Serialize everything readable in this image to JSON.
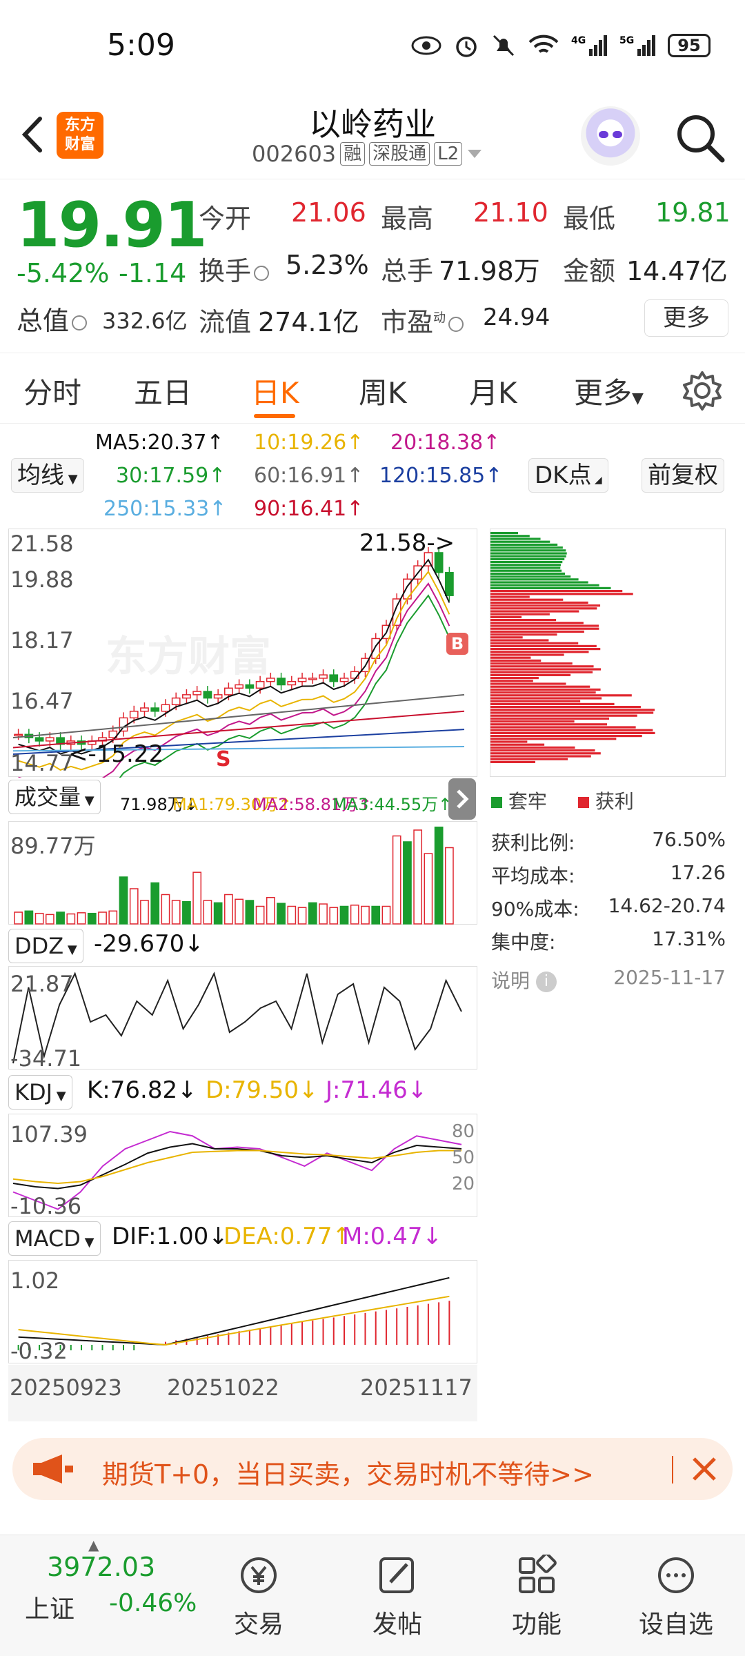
{
  "status_bar": {
    "time": "5:09",
    "battery": "95"
  },
  "header": {
    "logo_line1": "东方",
    "logo_line2": "财富",
    "stock_name": "以岭药业",
    "stock_code": "002603",
    "tag_margin": "融",
    "tag_connect": "深股通",
    "tag_level": "L2"
  },
  "quote": {
    "price": "19.91",
    "change_pct": "-5.42%",
    "change_val": "-1.14",
    "open_label": "今开",
    "open": "21.06",
    "high_label": "最高",
    "high": "21.10",
    "low_label": "最低",
    "low": "19.81",
    "turnover_label": "换手",
    "turnover": "5.23%",
    "volume_label": "总手",
    "volume": "71.98万",
    "amount_label": "金额",
    "amount": "14.47亿",
    "mktcap_label": "总值",
    "mktcap": "332.6亿",
    "float_label": "流值",
    "float_cap": "274.1亿",
    "pe_label": "市盈",
    "pe_sup": "动",
    "pe": "24.94",
    "more_label": "更多"
  },
  "tabs": [
    "分时",
    "五日",
    "日K",
    "周K",
    "月K",
    "更多"
  ],
  "ma_legend": {
    "ma5": "MA5:20.37↑",
    "ma10": "10:19.26↑",
    "ma20": "20:18.38↑",
    "ma30": "30:17.59↑",
    "ma60": "60:16.91↑",
    "ma120": "120:15.85↑",
    "ma250": "250:15.33↑",
    "ma90": "90:16.41↑",
    "ma_select": "均线",
    "dk_btn": "DK点",
    "fq_btn": "前复权"
  },
  "kline": {
    "y_labels": [
      "21.58",
      "19.88",
      "18.17",
      "16.47",
      "14.77"
    ],
    "high_marker": "21.58->",
    "low_marker": "<-15.22",
    "b_mark": "B",
    "s_mark": "S"
  },
  "volume": {
    "select": "成交量",
    "legend_vol": "71.98万↓",
    "ma1": "MA1:79.30万↑",
    "ma2": "MA2:58.81万↑",
    "ma3": "MA3:44.55万↑",
    "top_label": "89.77万"
  },
  "ddz": {
    "select": "DDZ",
    "value": "-29.670↓",
    "top": "21.87",
    "bottom": "-34.71"
  },
  "kdj": {
    "select": "KDJ",
    "k": "K:76.82↓",
    "d": "D:79.50↓",
    "j": "J:71.46↓",
    "top": "107.39",
    "bottom": "-10.36",
    "r80": "80",
    "r50": "50",
    "r20": "20"
  },
  "macd": {
    "select": "MACD",
    "dif": "DIF:1.00↓",
    "dea": "DEA:0.77↑",
    "m": "M:0.47↓",
    "top": "1.02",
    "bottom": "-0.32"
  },
  "dates": [
    "20250923",
    "20251022",
    "20251117"
  ],
  "chips": {
    "legend_locked": "套牢",
    "legend_profit": "获利",
    "rows": [
      {
        "label": "获利比例:",
        "value": "76.50%"
      },
      {
        "label": "平均成本:",
        "value": "17.26"
      },
      {
        "label": "90%成本:",
        "value": "14.62-20.74"
      },
      {
        "label": "集中度:",
        "value": "17.31%"
      }
    ],
    "note_label": "说明",
    "date": "2025-11-17"
  },
  "banner": {
    "text": "期货T+0，当日买卖，交易时机不等待>>"
  },
  "bottom_nav": {
    "index_value": "3972.03",
    "index_name": "上证",
    "index_change": "-0.46%",
    "trade": "交易",
    "post": "发帖",
    "function": "功能",
    "watchlist": "设自选"
  },
  "colors": {
    "up": "#e0262f",
    "down": "#1a9c2e",
    "accent": "#ff6a00",
    "ma5": "#111111",
    "ma10": "#e8b400",
    "ma20": "#c2188b",
    "ma30": "#1a9c2e",
    "ma60": "#666666",
    "ma120": "#1b3fa0",
    "ma250": "#5aaee0",
    "ma90": "#c8102e"
  }
}
